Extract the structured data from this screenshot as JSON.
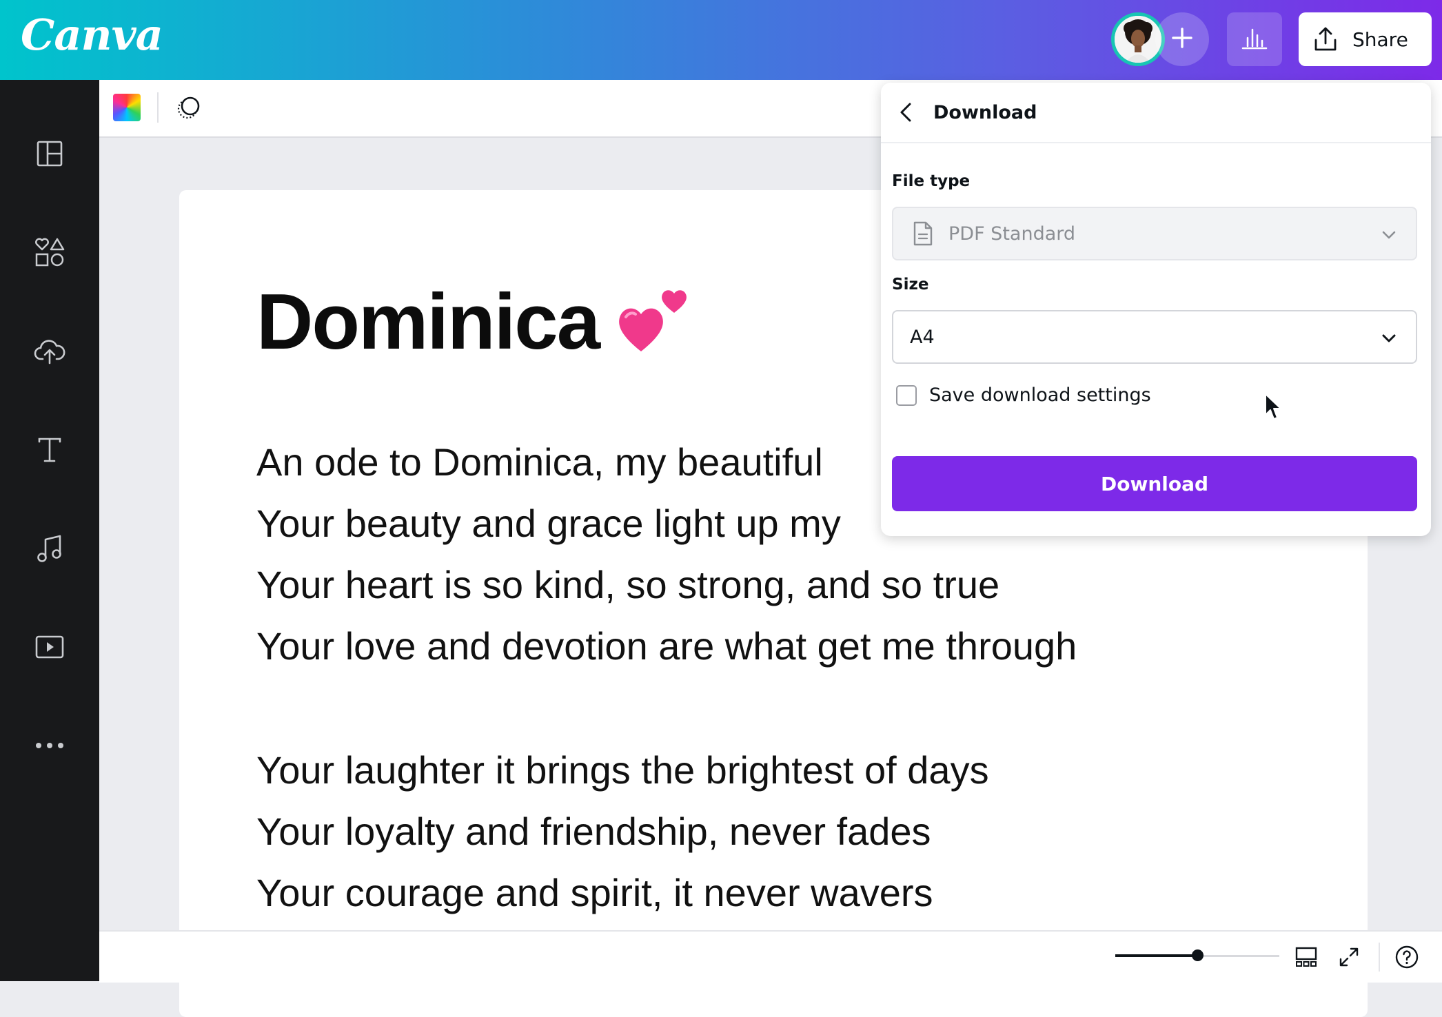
{
  "app": {
    "logo": "Canva"
  },
  "header": {
    "share_label": "Share"
  },
  "document": {
    "title": "Dominica",
    "title_emoji": "two-hearts",
    "lines": [
      "An ode to Dominica, my beautiful",
      "Your beauty and grace light up my",
      "Your heart is so kind, so strong, and so true",
      "Your love and devotion are what get me through",
      "",
      "Your laughter it brings the brightest of days",
      "Your loyalty and friendship, never fades",
      "Your courage and spirit, it never wavers"
    ]
  },
  "download_panel": {
    "title": "Download",
    "file_type_label": "File type",
    "file_type_value": "PDF Standard",
    "size_label": "Size",
    "size_value": "A4",
    "save_settings_label": "Save download settings",
    "save_settings_checked": false,
    "download_button": "Download"
  },
  "colors": {
    "brand_purple": "#7d2ae8",
    "gradient_start": "#00c4cc",
    "sidebar_bg": "#18191b"
  }
}
